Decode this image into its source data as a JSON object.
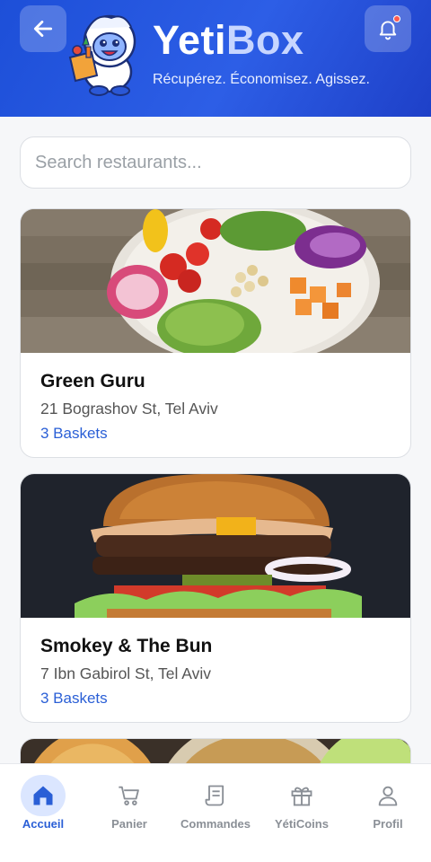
{
  "header": {
    "brand_primary": "Yeti",
    "brand_secondary": "Box",
    "tagline": "Récupérez. Économisez. Agissez.",
    "back_icon": "arrow-left-icon",
    "notification_icon": "bell-icon",
    "has_notification": true
  },
  "search": {
    "placeholder": "Search restaurants...",
    "value": ""
  },
  "restaurants": [
    {
      "name": "Green Guru",
      "address": "21 Bograshov St, Tel Aviv",
      "baskets": "3 Baskets",
      "image": "salad-bowl"
    },
    {
      "name": "Smokey & The Bun",
      "address": "7 Ibn Gabirol St, Tel Aviv",
      "baskets": "3 Baskets",
      "image": "burger"
    }
  ],
  "tabs": [
    {
      "label": "Accueil",
      "icon": "home-icon",
      "active": true
    },
    {
      "label": "Panier",
      "icon": "cart-icon",
      "active": false
    },
    {
      "label": "Commandes",
      "icon": "receipt-icon",
      "active": false
    },
    {
      "label": "YétiCoins",
      "icon": "gift-icon",
      "active": false
    },
    {
      "label": "Profil",
      "icon": "user-icon",
      "active": false
    }
  ],
  "colors": {
    "header": "#2d5ee6",
    "accent": "#2a5fd6",
    "notification_dot": "#ff5a4f"
  }
}
